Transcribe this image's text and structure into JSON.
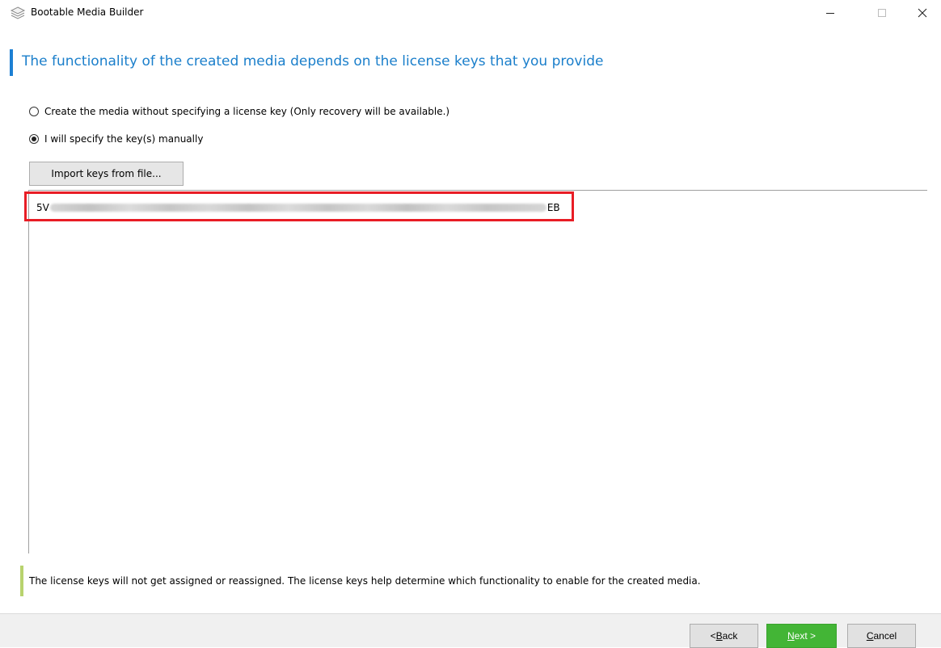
{
  "window": {
    "title": "Bootable Media Builder",
    "controls": {
      "minimize": "–",
      "maximize": "☐",
      "close": "✕"
    }
  },
  "header": {
    "title": "The functionality of the created media depends on the license keys that you provide",
    "accent_color": "#1d80d3"
  },
  "options": [
    {
      "label": "Create the media without specifying a license key (Only recovery will be available.)",
      "selected": false
    },
    {
      "label": "I will specify the key(s) manually",
      "selected": true
    }
  ],
  "import_button": {
    "label": "Import keys from file..."
  },
  "key_editor": {
    "visible_prefix": "5V",
    "visible_suffix": "EB",
    "masked": true,
    "highlight_color": "#e81d25"
  },
  "info": {
    "text": "The license keys will not get assigned or reassigned. The license keys help determine which functionality to enable for the created media.",
    "accent_color": "#b8d36e"
  },
  "footer": {
    "back": {
      "prefix": "< ",
      "mnemonic": "B",
      "rest": "ack"
    },
    "next": {
      "mnemonic": "N",
      "rest": "ext >"
    },
    "cancel": {
      "mnemonic": "C",
      "rest": "ancel"
    },
    "next_color": "#43b536"
  }
}
